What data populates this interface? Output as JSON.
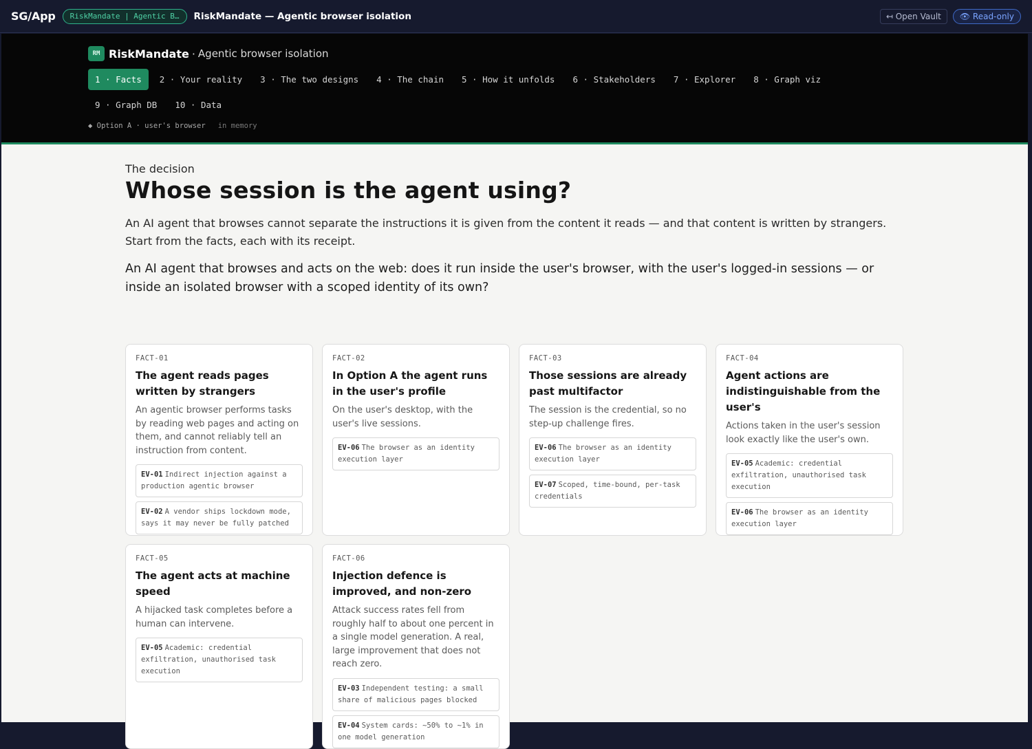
{
  "topbar": {
    "brand": "SG/App",
    "crumb": "RiskMandate | Agentic B…",
    "title": "RiskMandate — Agentic browser isolation",
    "open_vault": "↤ Open Vault",
    "read_only": "👁 Read-only"
  },
  "header": {
    "badge": "RM",
    "app_name": "RiskMandate",
    "separator": "·",
    "subtitle": "Agentic browser isolation",
    "tabs": [
      {
        "label": "1 · Facts"
      },
      {
        "label": "2 · Your reality"
      },
      {
        "label": "3 · The two designs"
      },
      {
        "label": "4 · The chain"
      },
      {
        "label": "5 · How it unfolds"
      },
      {
        "label": "6 · Stakeholders"
      },
      {
        "label": "7 · Explorer"
      },
      {
        "label": "8 · Graph viz"
      },
      {
        "label": "9 · Graph DB"
      },
      {
        "label": "10 · Data"
      }
    ],
    "status_option": "◆ Option A · user's browser",
    "status_state": "in memory"
  },
  "main": {
    "eyebrow": "The decision",
    "title": "Whose session is the agent using?",
    "lead": "An AI agent that browses cannot separate the instructions it is given from the content it reads — and that content is written by strangers. Start from the facts, each with its receipt.",
    "question": "An AI agent that browses and acts on the web: does it run inside the user's browser, with the user's logged-in sessions — or inside an isolated browser with a scoped identity of its own?",
    "facts": [
      {
        "id": "FACT-01",
        "title": "The agent reads pages written by strangers",
        "body": "An agentic browser performs tasks by reading web pages and acting on them, and cannot reliably tell an instruction from content.",
        "evidence": [
          {
            "id": "EV-01",
            "text": "Indirect injection against a production agentic browser"
          },
          {
            "id": "EV-02",
            "text": "A vendor ships lockdown mode, says it may never be fully patched"
          }
        ]
      },
      {
        "id": "FACT-02",
        "title": "In Option A the agent runs in the user's profile",
        "body": "On the user's desktop, with the user's live sessions.",
        "evidence": [
          {
            "id": "EV-06",
            "text": "The browser as an identity execution layer"
          }
        ]
      },
      {
        "id": "FACT-03",
        "title": "Those sessions are already past multifactor",
        "body": "The session is the credential, so no step-up challenge fires.",
        "evidence": [
          {
            "id": "EV-06",
            "text": "The browser as an identity execution layer"
          },
          {
            "id": "EV-07",
            "text": "Scoped, time-bound, per-task credentials"
          }
        ]
      },
      {
        "id": "FACT-04",
        "title": "Agent actions are indistinguishable from the user's",
        "body": "Actions taken in the user's session look exactly like the user's own.",
        "evidence": [
          {
            "id": "EV-05",
            "text": "Academic: credential exfiltration, unauthorised task execution"
          },
          {
            "id": "EV-06",
            "text": "The browser as an identity execution layer"
          }
        ]
      },
      {
        "id": "FACT-05",
        "title": "The agent acts at machine speed",
        "body": "A hijacked task completes before a human can intervene.",
        "evidence": [
          {
            "id": "EV-05",
            "text": "Academic: credential exfiltration, unauthorised task execution"
          }
        ]
      },
      {
        "id": "FACT-06",
        "title": "Injection defence is improved, and non-zero",
        "body": "Attack success rates fell from roughly half to about one percent in a single model generation. A real, large improvement that does not reach zero.",
        "evidence": [
          {
            "id": "EV-03",
            "text": "Independent testing: a small share of malicious pages blocked"
          },
          {
            "id": "EV-04",
            "text": "System cards: ~50% to ~1% in one model generation"
          }
        ]
      }
    ]
  }
}
